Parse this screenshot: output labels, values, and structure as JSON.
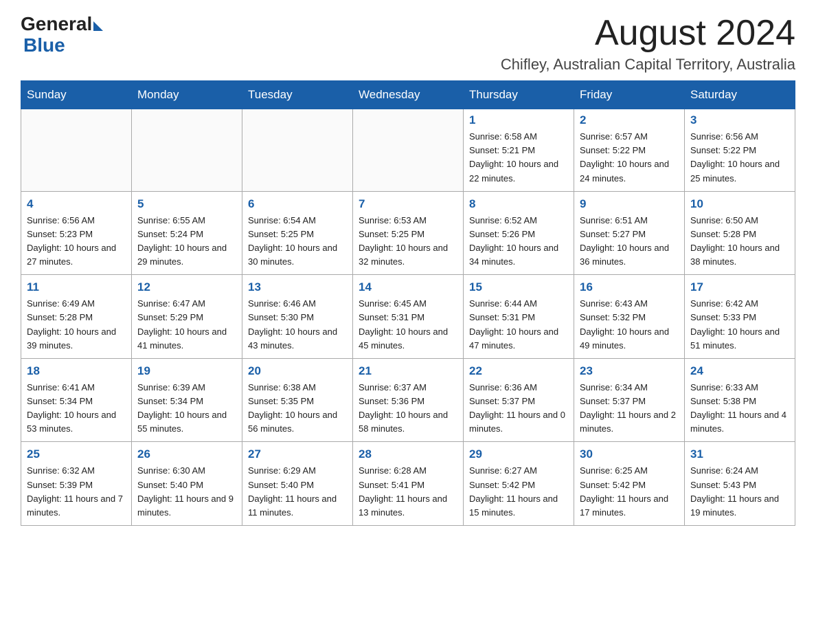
{
  "logo": {
    "general": "General",
    "blue": "Blue"
  },
  "title": {
    "month_year": "August 2024",
    "location": "Chifley, Australian Capital Territory, Australia"
  },
  "days_of_week": [
    "Sunday",
    "Monday",
    "Tuesday",
    "Wednesday",
    "Thursday",
    "Friday",
    "Saturday"
  ],
  "weeks": [
    [
      {
        "day": "",
        "info": ""
      },
      {
        "day": "",
        "info": ""
      },
      {
        "day": "",
        "info": ""
      },
      {
        "day": "",
        "info": ""
      },
      {
        "day": "1",
        "info": "Sunrise: 6:58 AM\nSunset: 5:21 PM\nDaylight: 10 hours and 22 minutes."
      },
      {
        "day": "2",
        "info": "Sunrise: 6:57 AM\nSunset: 5:22 PM\nDaylight: 10 hours and 24 minutes."
      },
      {
        "day": "3",
        "info": "Sunrise: 6:56 AM\nSunset: 5:22 PM\nDaylight: 10 hours and 25 minutes."
      }
    ],
    [
      {
        "day": "4",
        "info": "Sunrise: 6:56 AM\nSunset: 5:23 PM\nDaylight: 10 hours and 27 minutes."
      },
      {
        "day": "5",
        "info": "Sunrise: 6:55 AM\nSunset: 5:24 PM\nDaylight: 10 hours and 29 minutes."
      },
      {
        "day": "6",
        "info": "Sunrise: 6:54 AM\nSunset: 5:25 PM\nDaylight: 10 hours and 30 minutes."
      },
      {
        "day": "7",
        "info": "Sunrise: 6:53 AM\nSunset: 5:25 PM\nDaylight: 10 hours and 32 minutes."
      },
      {
        "day": "8",
        "info": "Sunrise: 6:52 AM\nSunset: 5:26 PM\nDaylight: 10 hours and 34 minutes."
      },
      {
        "day": "9",
        "info": "Sunrise: 6:51 AM\nSunset: 5:27 PM\nDaylight: 10 hours and 36 minutes."
      },
      {
        "day": "10",
        "info": "Sunrise: 6:50 AM\nSunset: 5:28 PM\nDaylight: 10 hours and 38 minutes."
      }
    ],
    [
      {
        "day": "11",
        "info": "Sunrise: 6:49 AM\nSunset: 5:28 PM\nDaylight: 10 hours and 39 minutes."
      },
      {
        "day": "12",
        "info": "Sunrise: 6:47 AM\nSunset: 5:29 PM\nDaylight: 10 hours and 41 minutes."
      },
      {
        "day": "13",
        "info": "Sunrise: 6:46 AM\nSunset: 5:30 PM\nDaylight: 10 hours and 43 minutes."
      },
      {
        "day": "14",
        "info": "Sunrise: 6:45 AM\nSunset: 5:31 PM\nDaylight: 10 hours and 45 minutes."
      },
      {
        "day": "15",
        "info": "Sunrise: 6:44 AM\nSunset: 5:31 PM\nDaylight: 10 hours and 47 minutes."
      },
      {
        "day": "16",
        "info": "Sunrise: 6:43 AM\nSunset: 5:32 PM\nDaylight: 10 hours and 49 minutes."
      },
      {
        "day": "17",
        "info": "Sunrise: 6:42 AM\nSunset: 5:33 PM\nDaylight: 10 hours and 51 minutes."
      }
    ],
    [
      {
        "day": "18",
        "info": "Sunrise: 6:41 AM\nSunset: 5:34 PM\nDaylight: 10 hours and 53 minutes."
      },
      {
        "day": "19",
        "info": "Sunrise: 6:39 AM\nSunset: 5:34 PM\nDaylight: 10 hours and 55 minutes."
      },
      {
        "day": "20",
        "info": "Sunrise: 6:38 AM\nSunset: 5:35 PM\nDaylight: 10 hours and 56 minutes."
      },
      {
        "day": "21",
        "info": "Sunrise: 6:37 AM\nSunset: 5:36 PM\nDaylight: 10 hours and 58 minutes."
      },
      {
        "day": "22",
        "info": "Sunrise: 6:36 AM\nSunset: 5:37 PM\nDaylight: 11 hours and 0 minutes."
      },
      {
        "day": "23",
        "info": "Sunrise: 6:34 AM\nSunset: 5:37 PM\nDaylight: 11 hours and 2 minutes."
      },
      {
        "day": "24",
        "info": "Sunrise: 6:33 AM\nSunset: 5:38 PM\nDaylight: 11 hours and 4 minutes."
      }
    ],
    [
      {
        "day": "25",
        "info": "Sunrise: 6:32 AM\nSunset: 5:39 PM\nDaylight: 11 hours and 7 minutes."
      },
      {
        "day": "26",
        "info": "Sunrise: 6:30 AM\nSunset: 5:40 PM\nDaylight: 11 hours and 9 minutes."
      },
      {
        "day": "27",
        "info": "Sunrise: 6:29 AM\nSunset: 5:40 PM\nDaylight: 11 hours and 11 minutes."
      },
      {
        "day": "28",
        "info": "Sunrise: 6:28 AM\nSunset: 5:41 PM\nDaylight: 11 hours and 13 minutes."
      },
      {
        "day": "29",
        "info": "Sunrise: 6:27 AM\nSunset: 5:42 PM\nDaylight: 11 hours and 15 minutes."
      },
      {
        "day": "30",
        "info": "Sunrise: 6:25 AM\nSunset: 5:42 PM\nDaylight: 11 hours and 17 minutes."
      },
      {
        "day": "31",
        "info": "Sunrise: 6:24 AM\nSunset: 5:43 PM\nDaylight: 11 hours and 19 minutes."
      }
    ]
  ]
}
